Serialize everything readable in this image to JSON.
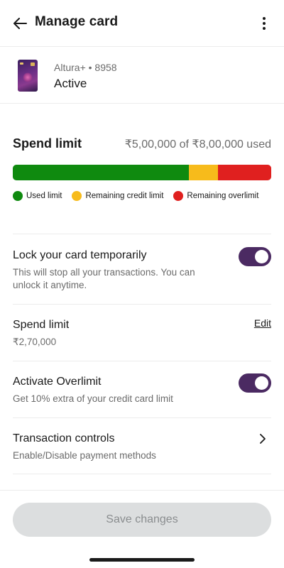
{
  "header": {
    "title": "Manage card",
    "back_icon": "arrow-left-icon",
    "more_icon": "more-vertical-icon"
  },
  "card": {
    "name": "Altura+ • 8958",
    "status": "Active"
  },
  "spend_summary": {
    "title": "Spend limit",
    "used_text": "₹5,00,000 of ₹8,00,000 used",
    "bar": {
      "used_fraction": 0.68,
      "remaining_credit_fraction": 0.115,
      "remaining_overlimit_fraction": 0.205
    },
    "legend": [
      {
        "label": "Used limit",
        "color": "#0f8a0f"
      },
      {
        "label": "Remaining credit limit",
        "color": "#f7bb1b"
      },
      {
        "label": "Remaining overlimit",
        "color": "#e0201f"
      }
    ]
  },
  "settings": {
    "lock": {
      "title": "Lock your card temporarily",
      "subtitle_line1": "This will stop all your transactions. You can",
      "subtitle_line2": "unlock it anytime.",
      "enabled": true
    },
    "spend_limit": {
      "title": "Spend limit",
      "value": "₹2,70,000",
      "edit_label": "Edit"
    },
    "overlimit": {
      "title": "Activate Overlimit",
      "subtitle": "Get 10% extra of your credit card limit",
      "enabled": true
    },
    "transaction_controls": {
      "title": "Transaction controls",
      "subtitle": "Enable/Disable payment methods"
    }
  },
  "footer": {
    "save_label": "Save changes"
  },
  "colors": {
    "accent_toggle": "#4b2a62",
    "button_disabled_bg": "#dcdedf",
    "button_disabled_text": "#8a8d8f"
  }
}
